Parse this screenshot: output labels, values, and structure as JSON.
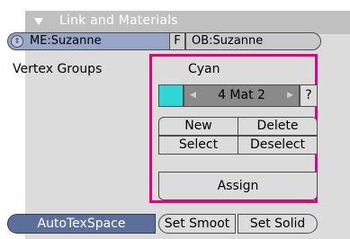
{
  "panel": {
    "title": "Link and Materials"
  },
  "mesh": {
    "me_label": "ME:Suzanne",
    "f_label": "F",
    "ob_label": "OB:Suzanne"
  },
  "vertex_groups": {
    "label": "Vertex Groups"
  },
  "material": {
    "name": "Cyan",
    "swatch_color": "#2fd6d6",
    "index_label": "4 Mat 2",
    "help": "?",
    "new_label": "New",
    "delete_label": "Delete",
    "select_label": "Select",
    "deselect_label": "Deselect",
    "assign_label": "Assign"
  },
  "footer": {
    "autotexspace_label": "AutoTexSpace",
    "set_smooth_label": "Set Smoot",
    "set_solid_label": "Set Solid"
  },
  "colors": {
    "highlight": "#e4007f",
    "header": "#c0c0c0",
    "panel_bg": "#dcdcdc"
  }
}
